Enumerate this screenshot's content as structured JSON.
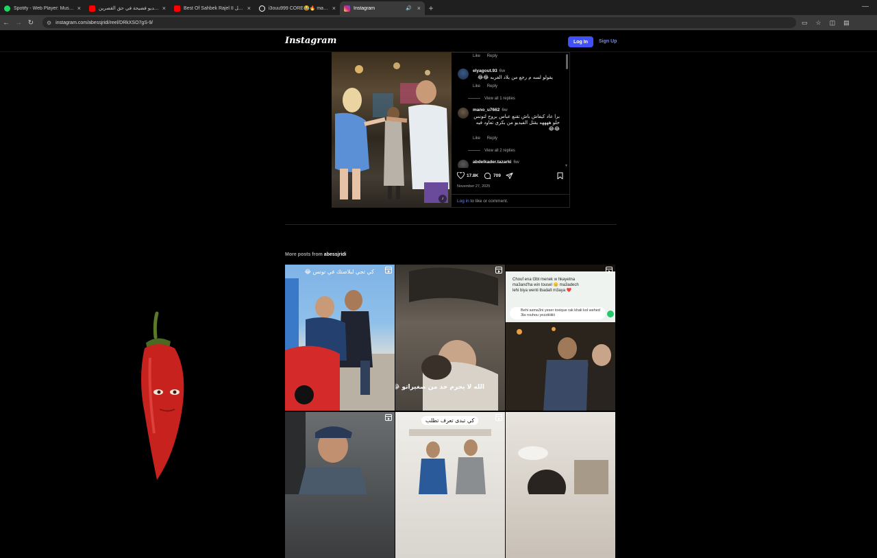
{
  "browser": {
    "tabs": [
      {
        "title": "Spotify - Web Player: Music fo",
        "fav": "#1ed760"
      },
      {
        "title": "فيديو فضيحة في حق القصرين -",
        "fav": "#ff0000"
      },
      {
        "title": "Best Of Sahbek Rajel II صاحبك راجل",
        "fav": "#ff0000"
      },
      {
        "title": "i3ouu999 CORE😂🔥 ma #explore",
        "fav": "#ffffff"
      },
      {
        "title": "Instagram",
        "fav": "#d6249f"
      }
    ],
    "url": "instagram.com/abessjridi/reel/DRkXSO7gS-9/"
  },
  "header": {
    "logo": "Instagram",
    "login": "Log In",
    "signup": "Sign Up"
  },
  "comments": {
    "like": "Like",
    "reply": "Reply",
    "items": [
      {
        "user": "elyagout.93",
        "age": "6w",
        "text": "يقولو لسه م رجع من بلاد الغربه 😂😂",
        "view_replies": "View all 1 replies"
      },
      {
        "user": "mano_u7662",
        "age": "6w",
        "text": "برا عاد كيفاش باش تقنع عباس بروح لتونس حلو ههههه يقتل الفيديو من بكري تعاود فيه 😂😂",
        "view_replies": "View all 2 replies"
      },
      {
        "user": "abdelkader.tazarki",
        "age": "6w"
      }
    ]
  },
  "post": {
    "likes": "17.8K",
    "comments": "709",
    "date": "November 27, 2025",
    "cta_link": "Log in",
    "cta_rest": " to like or comment."
  },
  "more_posts": {
    "label": "More posts from ",
    "account": "abessjridi"
  },
  "grid": {
    "cap1": "كي تجي لبلاصتك في تونس 😂",
    "cap2": "الله لا يحرم حد من صغيراتو 😂",
    "cap5": "كي تبدى تعرف تطلب",
    "chat_lines": [
      "Chouf ena t3bt menek w hkayetna",
      "ma3and'ha win tousel 😑 ma3adech",
      "lehi biya wenti tbadalt m3aya ❤️"
    ],
    "chat_input": "Behi asma3ni yeser toxique rak khali kol wehed 3la rouhou yezziiiiiiiii"
  }
}
